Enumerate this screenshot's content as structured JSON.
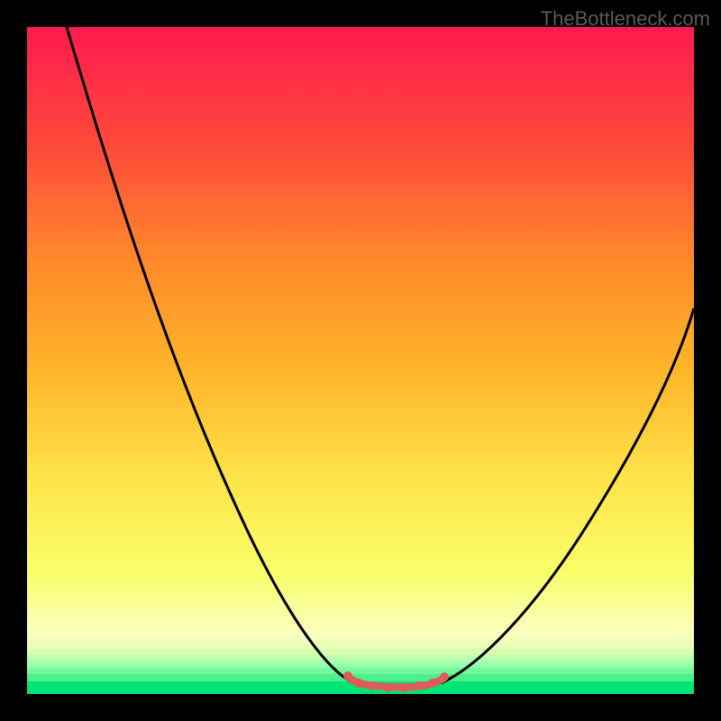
{
  "watermark": "TheBottleneck.com",
  "chart_data": {
    "type": "line",
    "title": "",
    "xlabel": "",
    "ylabel": "",
    "xlim": [
      0,
      100
    ],
    "ylim": [
      0,
      100
    ],
    "gradient_colors": {
      "top": "#ff1a4f",
      "upper_mid": "#ff7a2a",
      "mid": "#ffb62a",
      "lower_mid": "#ffe44a",
      "lower": "#f5ff7a",
      "bottom_band": "#8effad",
      "bottom": "#00e676"
    },
    "curve_left": [
      {
        "x": 6,
        "y": 100
      },
      {
        "x": 18,
        "y": 60
      },
      {
        "x": 32,
        "y": 28
      },
      {
        "x": 44,
        "y": 6
      },
      {
        "x": 49,
        "y": 1.5
      }
    ],
    "curve_right": [
      {
        "x": 62,
        "y": 1.5
      },
      {
        "x": 70,
        "y": 8
      },
      {
        "x": 82,
        "y": 25
      },
      {
        "x": 92,
        "y": 42
      },
      {
        "x": 100,
        "y": 58
      }
    ],
    "red_segment": {
      "start_x": 49,
      "end_x": 62,
      "y": 1.2,
      "color": "#e05a5a"
    },
    "red_dots": [
      {
        "x": 48.5,
        "y": 2.2
      },
      {
        "x": 49.8,
        "y": 1.3
      },
      {
        "x": 52,
        "y": 1.1
      },
      {
        "x": 54,
        "y": 1.0
      },
      {
        "x": 56,
        "y": 1.0
      },
      {
        "x": 58,
        "y": 1.1
      },
      {
        "x": 60,
        "y": 1.3
      },
      {
        "x": 61.8,
        "y": 2.0
      }
    ]
  }
}
